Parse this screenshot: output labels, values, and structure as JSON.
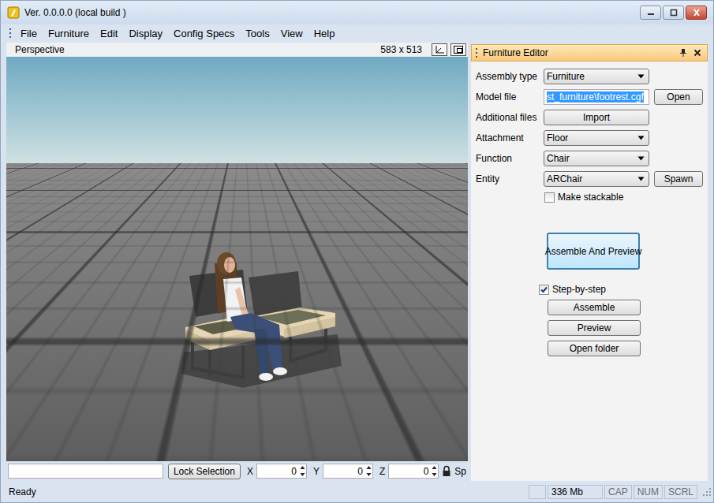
{
  "window": {
    "title": "Ver. 0.0.0.0 (local build )"
  },
  "menu": [
    "File",
    "Furniture",
    "Edit",
    "Display",
    "Config Specs",
    "Tools",
    "View",
    "Help"
  ],
  "viewport": {
    "label": "Perspective",
    "size": "583 x 513"
  },
  "viewport_toolbar": {
    "field": "",
    "lock_button": "Lock Selection",
    "coords": [
      {
        "axis": "X",
        "value": "0"
      },
      {
        "axis": "Y",
        "value": "0"
      },
      {
        "axis": "Z",
        "value": "0"
      }
    ],
    "cut_label": "Sp"
  },
  "panel": {
    "title": "Furniture Editor",
    "fields": [
      {
        "label": "Assembly type",
        "kind": "select",
        "value": "Furniture"
      },
      {
        "label": "Model file",
        "kind": "text",
        "value": "st_furniture\\footrest.cgf",
        "highlighted": true,
        "button": "Open"
      },
      {
        "label": "Additional files",
        "kind": "button",
        "value": "Import"
      },
      {
        "label": "Attachment",
        "kind": "select",
        "value": "Floor"
      },
      {
        "label": "Function",
        "kind": "select",
        "value": "Chair"
      },
      {
        "label": "Entity",
        "kind": "select",
        "value": "ARChair",
        "button": "Spawn"
      }
    ],
    "stackable": {
      "label": "Make stackable",
      "checked": false
    },
    "main_button": "Assemble And Preview",
    "step": {
      "label": "Step-by-step",
      "checked": true
    },
    "step_buttons": [
      "Assemble",
      "Preview",
      "Open folder"
    ]
  },
  "status_bar": {
    "text": "Ready",
    "memory": "336 Mb",
    "indicators": [
      {
        "label": "CAP",
        "on": false
      },
      {
        "label": "NUM",
        "on": false
      },
      {
        "label": "SCRL",
        "on": false
      }
    ]
  }
}
